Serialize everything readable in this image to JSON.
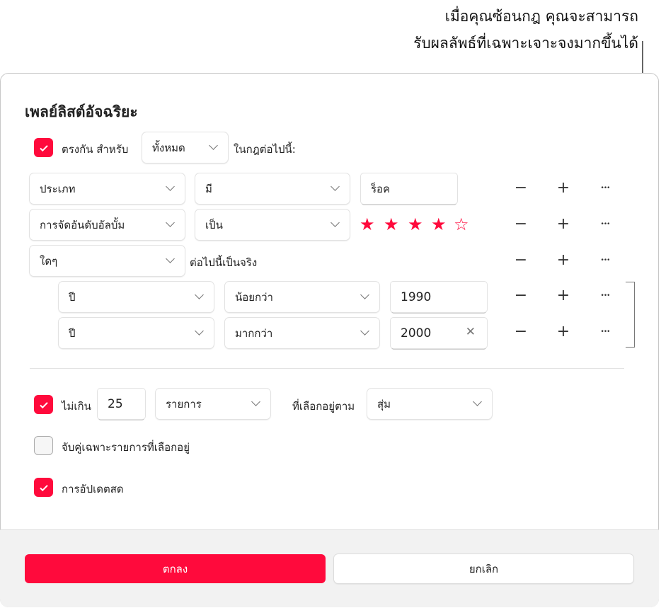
{
  "callout": {
    "line1": "เมื่อคุณซ้อนกฎ คุณจะสามารถ",
    "line2": "รับผลลัพธ์ที่เฉพาะเจาะจงมากขึ้นได้"
  },
  "dialog": {
    "title": "เพลย์ลิสต์อัจฉริยะ",
    "match": {
      "checked": true,
      "label": "ตรงกัน สำหรับ",
      "selector": "ทั้งหมด",
      "suffix": "ในกฎต่อไปนี้:"
    },
    "rules": [
      {
        "field": "ประเภท",
        "operator": "มี",
        "value": "ร็อค"
      },
      {
        "field": "การจัดอันดับอัลบั้ม",
        "operator": "เป็น",
        "rating": 4,
        "rating_max": 5
      },
      {
        "field": "ใดๆ",
        "suffix": "ต่อไปนี้เป็นจริง"
      }
    ],
    "nested_rules": [
      {
        "field": "ปี",
        "operator": "น้อยกว่า",
        "value": "1990"
      },
      {
        "field": "ปี",
        "operator": "มากกว่า",
        "value": "2000"
      }
    ],
    "limit": {
      "checked": true,
      "label": "ไม่เกิน",
      "value": "25",
      "unit": "รายการ",
      "by_label": "ที่เลือกอยู่ตาม",
      "by": "สุ่ม"
    },
    "match_checked": {
      "checked": false,
      "label": "จับคู่เฉพาะรายการที่เลือกอยู่"
    },
    "live_update": {
      "checked": true,
      "label": "การอัปเดตสด"
    },
    "ok_label": "ตกลง",
    "cancel_label": "ยกเลิก",
    "accent": "#ff0a3c"
  }
}
